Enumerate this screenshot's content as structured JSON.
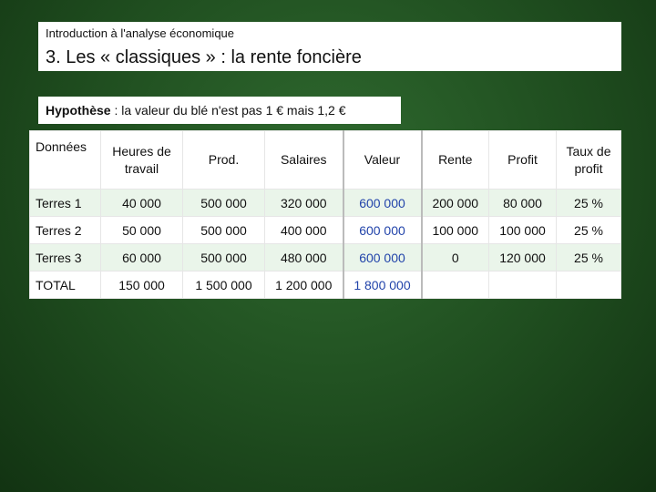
{
  "header": {
    "subtitle": "Introduction à l'analyse économique",
    "title_prefix": "3. Les « classiques » : ",
    "title_emph": "la rente foncière"
  },
  "hypothesis": {
    "label": "Hypothèse",
    "text": " : la valeur du blé n'est pas 1 € mais 1,2 €"
  },
  "table": {
    "headers": [
      "Données",
      "Heures de travail",
      "Prod.",
      "Salaires",
      "Valeur",
      "Rente",
      "Profit",
      "Taux de profit"
    ],
    "rows": [
      [
        "Terres 1",
        "40 000",
        "500 000",
        "320 000",
        "600 000",
        "200 000",
        "80 000",
        "25 %"
      ],
      [
        "Terres 2",
        "50 000",
        "500 000",
        "400 000",
        "600 000",
        "100 000",
        "100 000",
        "25 %"
      ],
      [
        "Terres 3",
        "60 000",
        "500 000",
        "480 000",
        "600 000",
        "0",
        "120 000",
        "25 %"
      ],
      [
        "TOTAL",
        "150 000",
        "1 500 000",
        "1 200 000",
        "1 800 000",
        "",
        "",
        ""
      ]
    ]
  }
}
